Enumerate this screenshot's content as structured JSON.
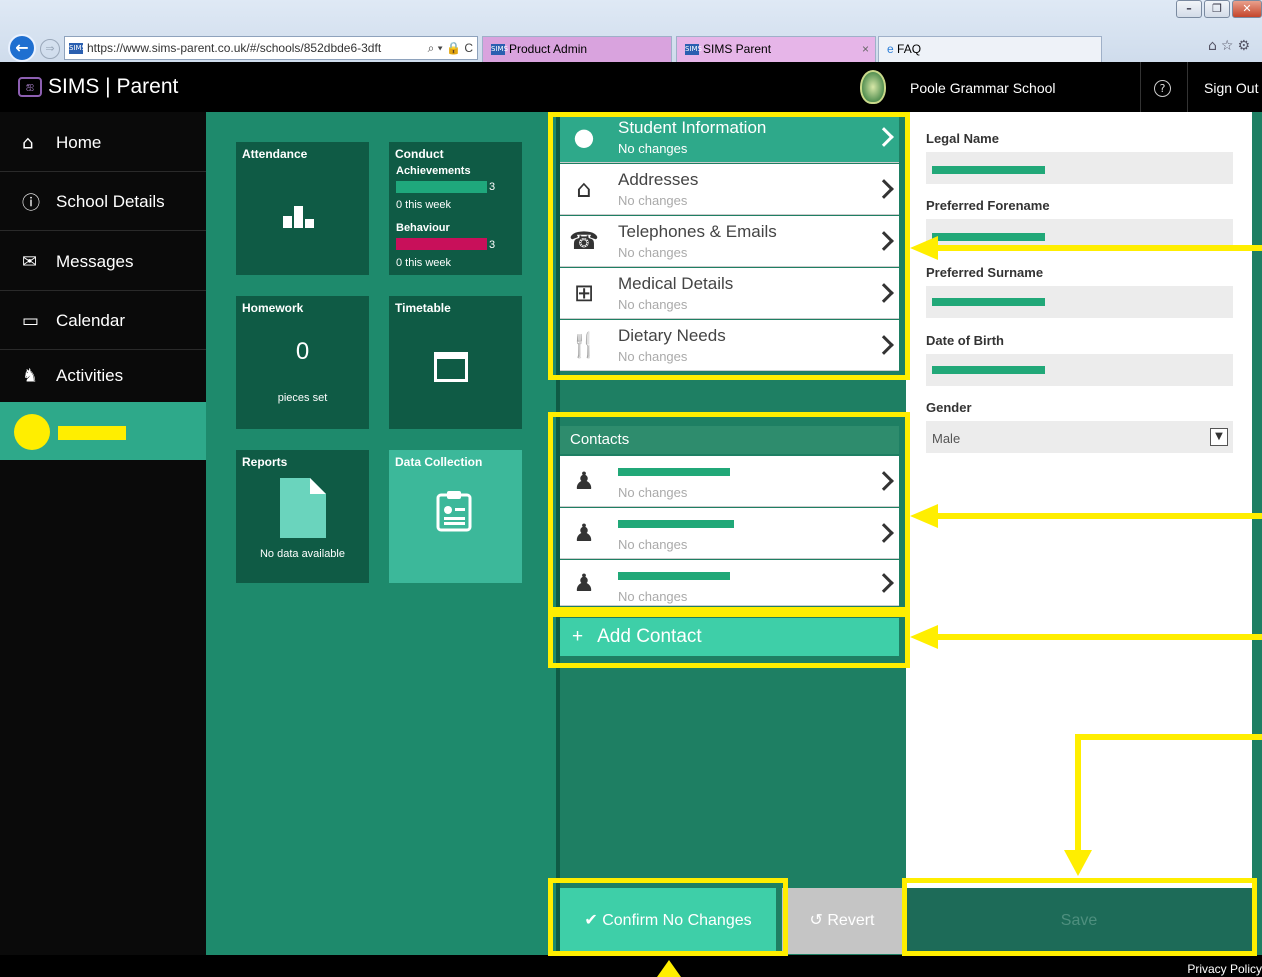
{
  "browser": {
    "url": "https://www.sims-parent.co.uk/#/schools/852dbde6-3dft",
    "url_tools": "⌕ ▾ 🔒 C",
    "tabs": [
      {
        "label": "Product Admin"
      },
      {
        "label": "SIMS Parent",
        "close": "×"
      },
      {
        "label": "FAQ"
      }
    ]
  },
  "app": {
    "title": "SIMS | Parent",
    "school_name": "Poole Grammar School",
    "help": "?",
    "sign_out": "Sign Out"
  },
  "sidebar": {
    "items": [
      {
        "label": "Home",
        "icon": "home-icon",
        "glyph": "⌂"
      },
      {
        "label": "School Details",
        "icon": "info-icon",
        "glyph": "ⓘ"
      },
      {
        "label": "Messages",
        "icon": "envelope-icon",
        "glyph": "✉"
      },
      {
        "label": "Calendar",
        "icon": "calendar-icon",
        "glyph": "▭"
      },
      {
        "label": "Activities",
        "icon": "chess-knight-icon",
        "glyph": "♞"
      }
    ]
  },
  "tiles": {
    "attendance": {
      "title": "Attendance"
    },
    "conduct": {
      "title": "Conduct",
      "achievements_label": "Achievements",
      "achievements_count": "3",
      "achievements_week": "0 this week",
      "behaviour_label": "Behaviour",
      "behaviour_count": "3",
      "behaviour_week": "0 this week",
      "achievements_color": "#1fa87c",
      "behaviour_color": "#c8105a"
    },
    "homework": {
      "title": "Homework",
      "count": "0",
      "caption": "pieces set"
    },
    "timetable": {
      "title": "Timetable"
    },
    "reports": {
      "title": "Reports",
      "caption": "No data available"
    },
    "data_collection": {
      "title": "Data Collection"
    }
  },
  "sections": [
    {
      "title": "Student Information",
      "status": "No changes",
      "icon": "person-icon"
    },
    {
      "title": "Addresses",
      "status": "No changes",
      "icon": "house-icon"
    },
    {
      "title": "Telephones & Emails",
      "status": "No changes",
      "icon": "phone-icon"
    },
    {
      "title": "Medical Details",
      "status": "No changes",
      "icon": "medical-kit-icon"
    },
    {
      "title": "Dietary Needs",
      "status": "No changes",
      "icon": "cutlery-icon"
    }
  ],
  "contacts": {
    "header": "Contacts",
    "items": [
      {
        "status": "No changes"
      },
      {
        "status": "No changes"
      },
      {
        "status": "No changes"
      }
    ],
    "add_label": "Add Contact",
    "add_glyph": "+"
  },
  "form": {
    "legal_name_label": "Legal Name",
    "preferred_forename_label": "Preferred Forename",
    "preferred_surname_label": "Preferred Surname",
    "dob_label": "Date of Birth",
    "gender_label": "Gender",
    "gender_value": "Male"
  },
  "actions": {
    "confirm_label": "Confirm No Changes",
    "confirm_glyph": "✔",
    "revert_label": "Revert",
    "revert_glyph": "↺",
    "save_label": "Save"
  },
  "footer": {
    "privacy": "Privacy Policy"
  },
  "colors": {
    "annotation": "#ffee00",
    "accent": "#2ea98a",
    "dark_green": "#0f5b45"
  }
}
